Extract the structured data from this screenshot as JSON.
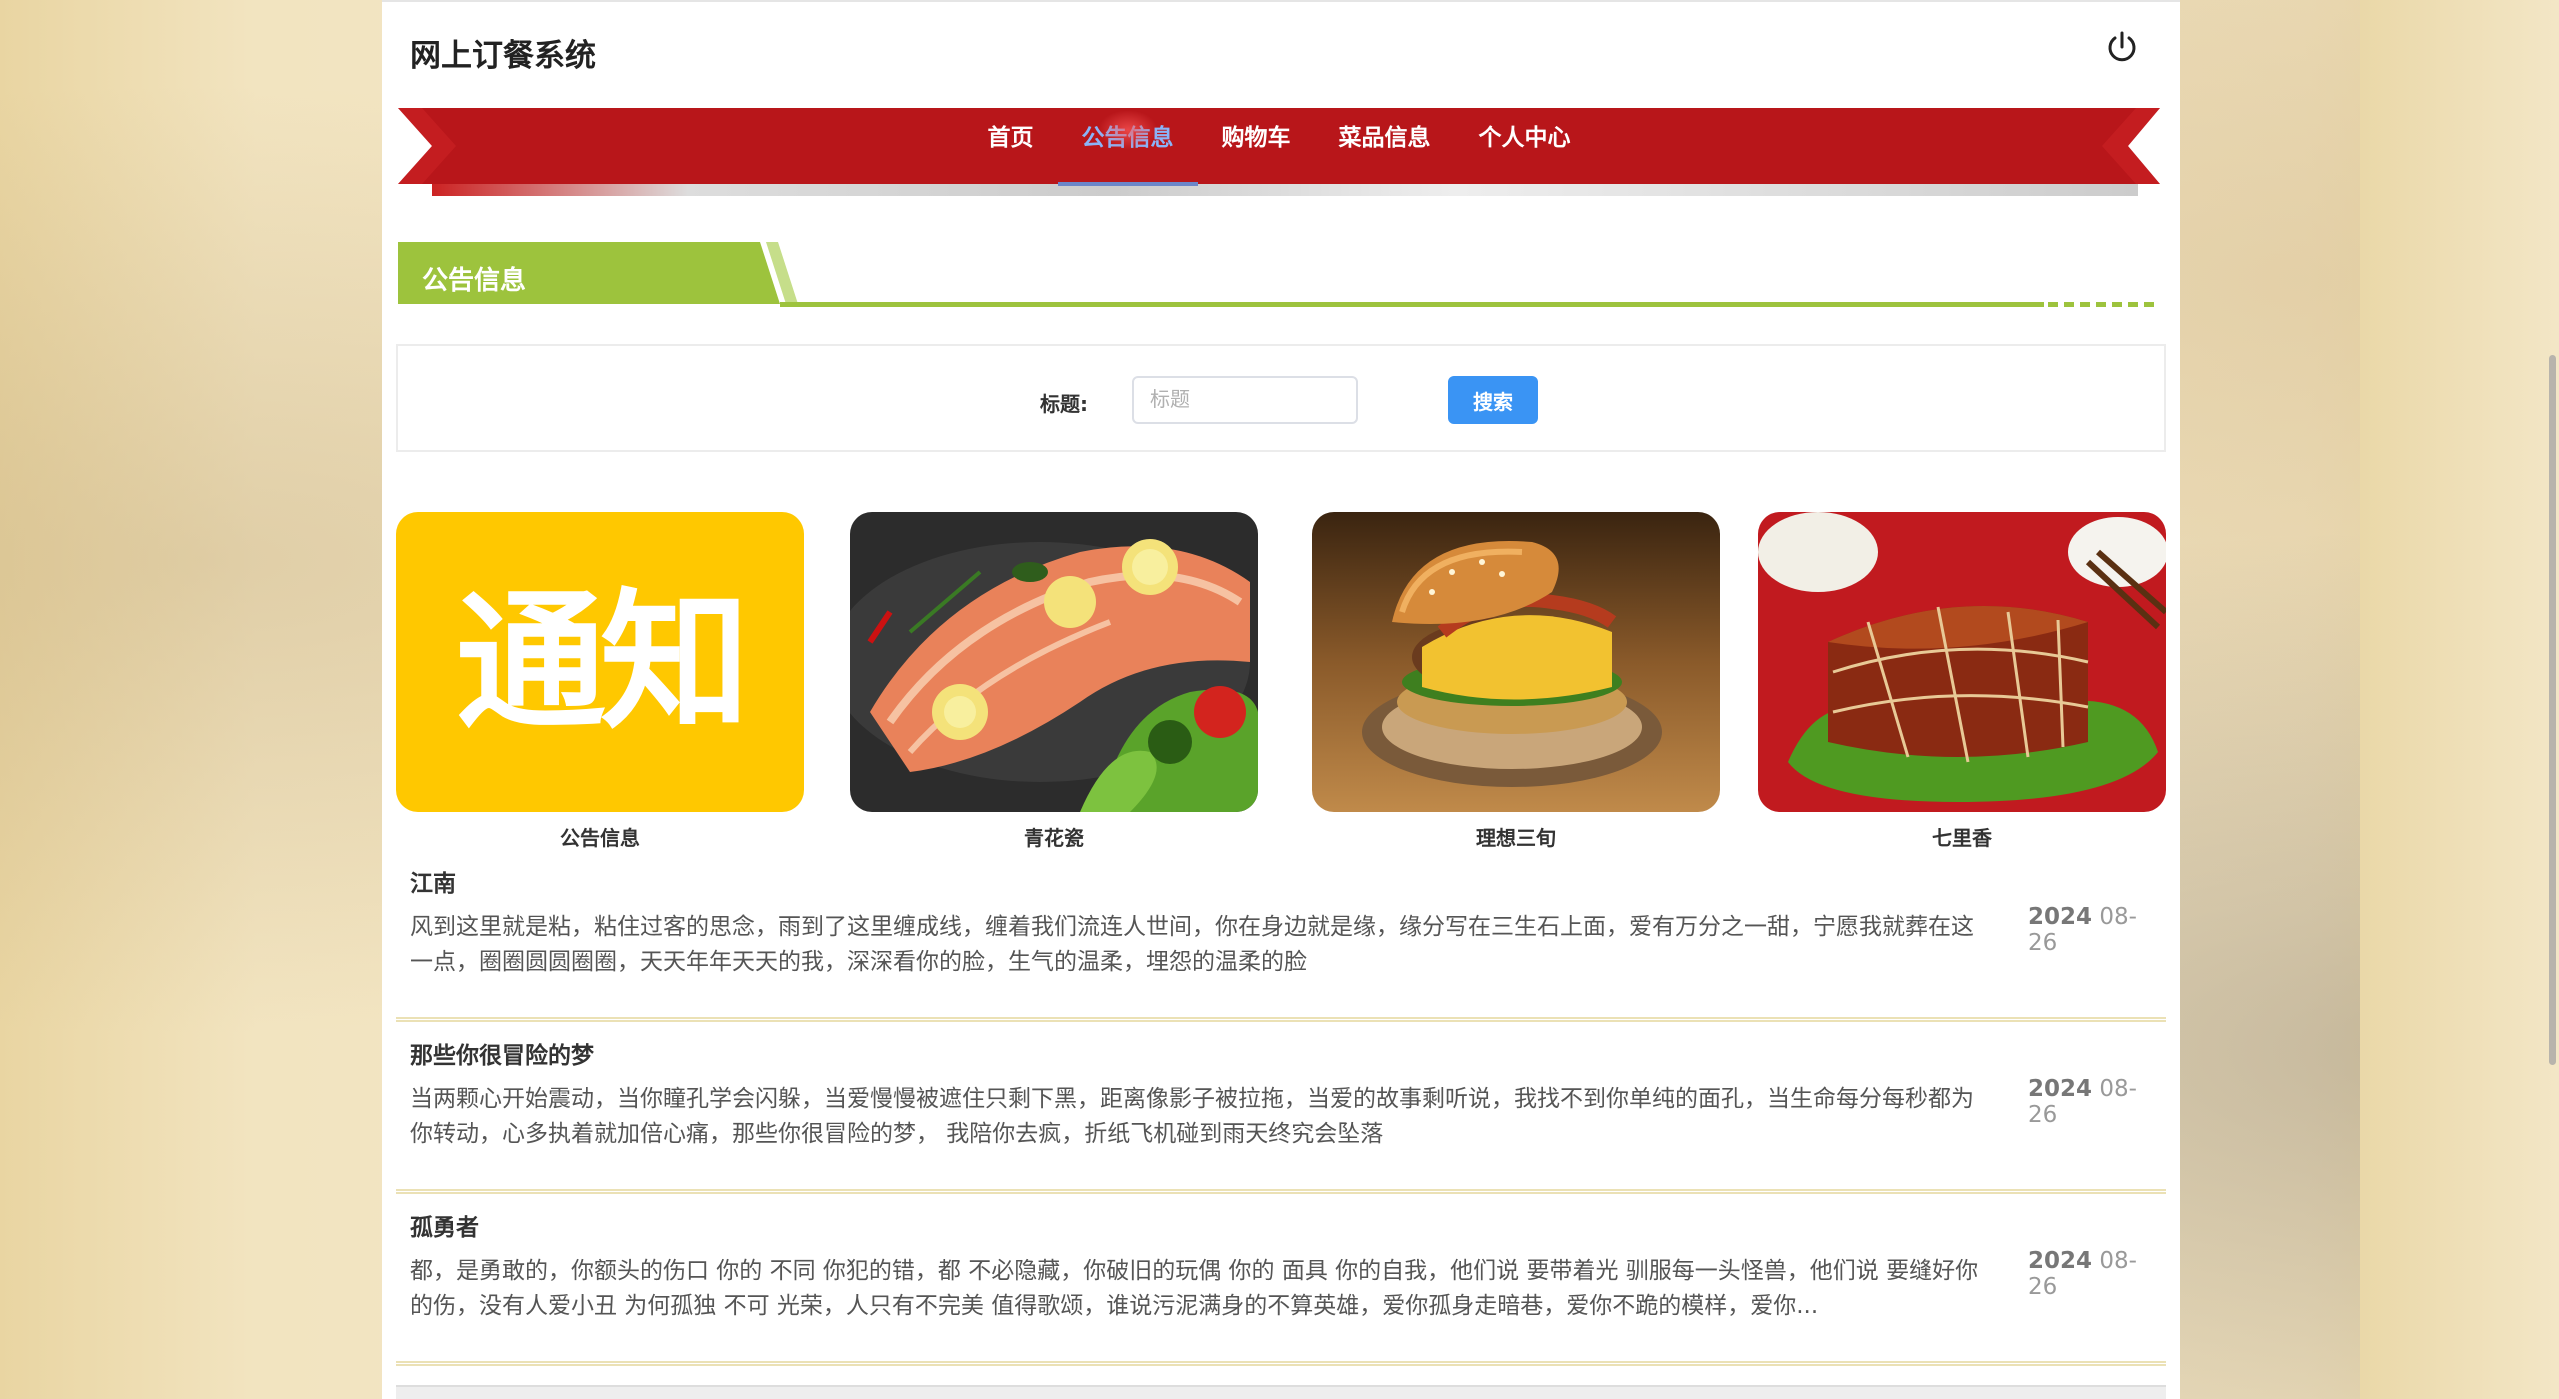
{
  "app": {
    "title": "网上订餐系统",
    "power_icon": "power-icon"
  },
  "nav": {
    "items": [
      {
        "label": "首页"
      },
      {
        "label": "公告信息"
      },
      {
        "label": "购物车"
      },
      {
        "label": "菜品信息"
      },
      {
        "label": "个人中心"
      }
    ],
    "active": "公告信息",
    "ribbon_color": "#b8161a"
  },
  "section": {
    "title": "公告信息",
    "accent_color": "#9dc33d"
  },
  "search": {
    "label": "标题:",
    "placeholder": "标题",
    "value": "",
    "button": "搜索",
    "button_color": "#3a94f4"
  },
  "cards": [
    {
      "caption": "公告信息",
      "image": "通知",
      "image_text": "通知"
    },
    {
      "caption": "青花瓷",
      "image": "salmon-dish"
    },
    {
      "caption": "理想三旬",
      "image": "burger"
    },
    {
      "caption": "七里香",
      "image": "braised-pork"
    }
  ],
  "notices": [
    {
      "title": "江南",
      "body": "风到这里就是粘，粘住过客的思念，雨到了这里缠成线，缠着我们流连人世间，你在身边就是缘，缘分写在三生石上面，爱有万分之一甜，宁愿我就葬在这一点，圈圈圆圆圈圈，天天年年天天的我，深深看你的脸，生气的温柔，埋怨的温柔的脸",
      "year": "2024",
      "date": "08-26"
    },
    {
      "title": "那些你很冒险的梦",
      "body": "当两颗心开始震动，当你瞳孔学会闪躲，当爱慢慢被遮住只剩下黑，距离像影子被拉拖，当爱的故事剩听说，我找不到你单纯的面孔，当生命每分每秒都为你转动，心多执着就加倍心痛，那些你很冒险的梦， 我陪你去疯，折纸飞机碰到雨天终究会坠落",
      "year": "2024",
      "date": "08-26"
    },
    {
      "title": "孤勇者",
      "body": "都，是勇敢的，你额头的伤口 你的 不同 你犯的错，都 不必隐藏，你破旧的玩偶 你的 面具 你的自我，他们说 要带着光 驯服每一头怪兽，他们说 要缝好你的伤，没有人爱小丑 为何孤独 不可 光荣，人只有不完美 值得歌颂，谁说污泥满身的不算英雄，爱你孤身走暗巷，爱你不跪的模样，爱你...",
      "year": "2024",
      "date": "08-26"
    }
  ]
}
